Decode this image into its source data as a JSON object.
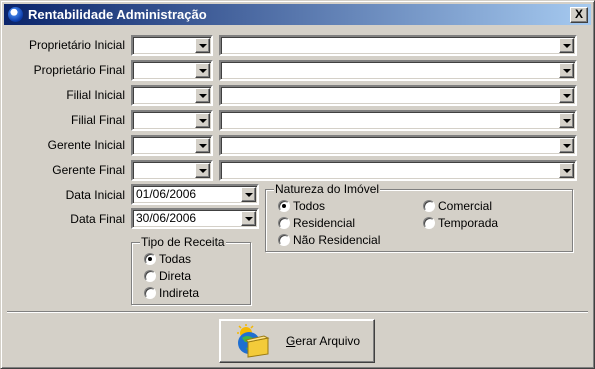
{
  "window": {
    "title": "Rentabilidade Administração",
    "close_label": "X"
  },
  "fields": [
    {
      "label": "Proprietário Inicial",
      "code": "",
      "name": ""
    },
    {
      "label": "Proprietário Final",
      "code": "",
      "name": ""
    },
    {
      "label": "Filial Inicial",
      "code": "",
      "name": ""
    },
    {
      "label": "Filial Final",
      "code": "",
      "name": ""
    },
    {
      "label": "Gerente Inicial",
      "code": "",
      "name": ""
    },
    {
      "label": "Gerente Final",
      "code": "",
      "name": ""
    }
  ],
  "dates": {
    "start_label": "Data Inicial",
    "start_value": "01/06/2006",
    "end_label": "Data Final",
    "end_value": "30/06/2006"
  },
  "tipo_receita": {
    "title": "Tipo de Receita",
    "options": [
      "Todas",
      "Direta",
      "Indireta"
    ],
    "selected": "Todas"
  },
  "natureza_imovel": {
    "title": "Natureza do Imóvel",
    "options": [
      "Todos",
      "Comercial",
      "Residencial",
      "Temporada",
      "Não Residencial"
    ],
    "selected": "Todos"
  },
  "actions": {
    "generate_label": "Gerar Arquivo",
    "generate_hotkey": "G",
    "generate_rest": "erar Arquivo"
  }
}
